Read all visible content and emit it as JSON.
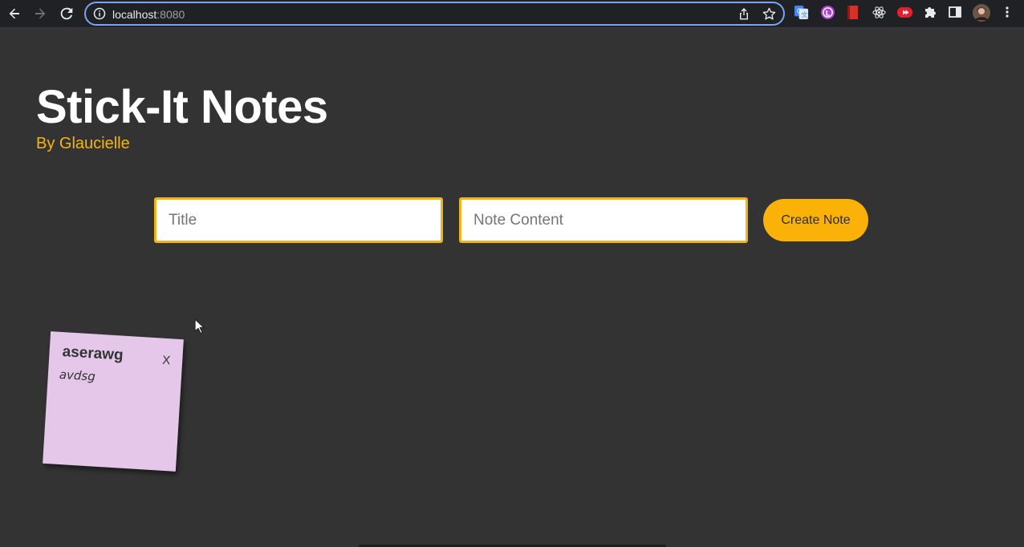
{
  "browser": {
    "url_host": "localhost",
    "url_port": ":8080",
    "icons": {
      "back": "arrow-left-icon",
      "forward": "arrow-right-icon",
      "reload": "reload-icon",
      "info": "info-icon",
      "share": "share-icon",
      "bookmark": "star-icon",
      "extensions": [
        "translate-icon",
        "extension-l-icon",
        "book-extension-icon",
        "react-devtools-icon",
        "redux-icon",
        "puzzle-icon",
        "side-panel-icon",
        "profile-avatar",
        "kebab-menu-icon"
      ]
    }
  },
  "page": {
    "title": "Stick-It Notes",
    "author": "By Glaucielle"
  },
  "form": {
    "title_placeholder": "Title",
    "content_placeholder": "Note Content",
    "create_label": "Create Note"
  },
  "notes": [
    {
      "title": "aserawg",
      "close_label": "X",
      "content": "avdsg",
      "color": "#e4c7e9"
    }
  ],
  "colors": {
    "background": "#333333",
    "accent": "#fbb208",
    "author": "#f5b50a",
    "input_border": "#f2b21a"
  }
}
